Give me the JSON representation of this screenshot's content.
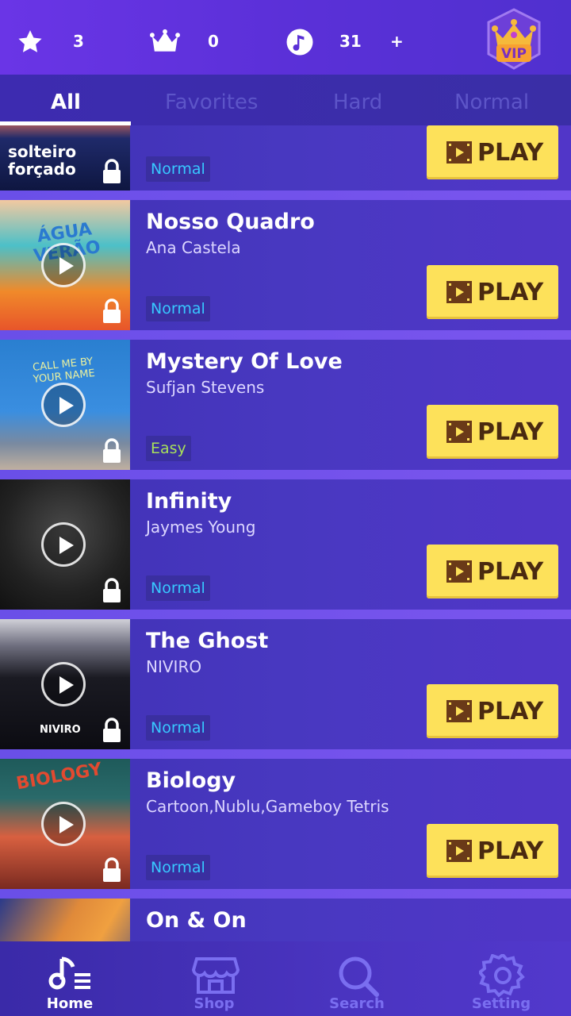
{
  "header": {
    "stars": "3",
    "crowns": "0",
    "notes": "31",
    "plus": "+",
    "vip": "VIP"
  },
  "tabs": [
    {
      "label": "All"
    },
    {
      "label": "Favorites"
    },
    {
      "label": "Hard"
    },
    {
      "label": "Normal"
    }
  ],
  "play_label": "PLAY",
  "songs": [
    {
      "cover_text": "solteiro forçado",
      "title": "",
      "artist": "",
      "difficulty": "Normal"
    },
    {
      "cover_text": "ÁGUA VERÃO",
      "title": "Nosso Quadro",
      "artist": "Ana Castela",
      "difficulty": "Normal"
    },
    {
      "cover_text": "CALL ME BY YOUR NAME",
      "title": "Mystery Of Love",
      "artist": "Sufjan Stevens",
      "difficulty": "Easy"
    },
    {
      "cover_text": "",
      "title": "Infinity",
      "artist": "Jaymes Young",
      "difficulty": "Normal"
    },
    {
      "cover_text": "NIVIRO",
      "title": "The Ghost",
      "artist": "NIVIRO",
      "difficulty": "Normal"
    },
    {
      "cover_text": "BIOLOGY",
      "title": "Biology",
      "artist": "Cartoon,Nublu,Gameboy Tetris",
      "difficulty": "Normal"
    },
    {
      "cover_text": "",
      "title": "On & On",
      "artist": "",
      "difficulty": ""
    }
  ],
  "nav": [
    {
      "label": "Home",
      "icon": "music-list-icon"
    },
    {
      "label": "Shop",
      "icon": "shop-icon"
    },
    {
      "label": "Search",
      "icon": "search-icon"
    },
    {
      "label": "Setting",
      "icon": "gear-icon"
    }
  ],
  "colors": {
    "play_button": "#fde15a",
    "normal_badge": "#38c8ff",
    "easy_badge": "#a8e05a"
  }
}
